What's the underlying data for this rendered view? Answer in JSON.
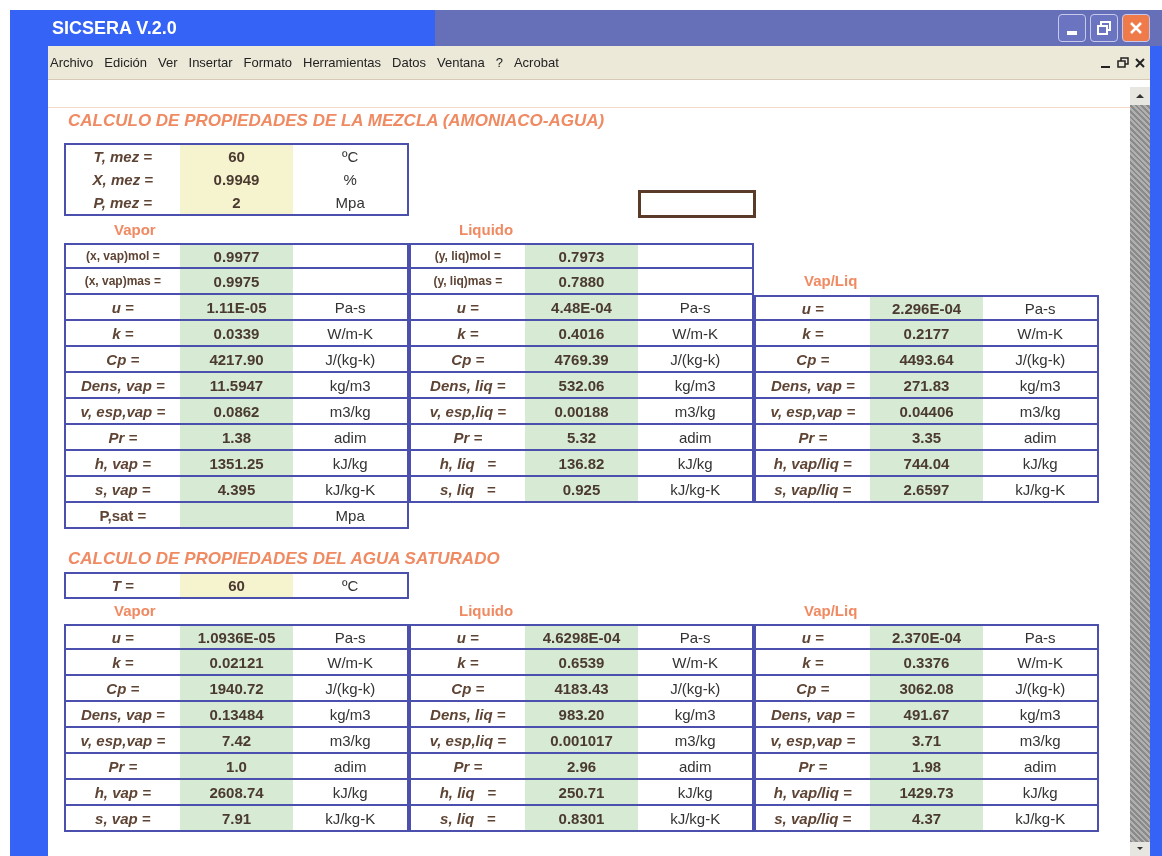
{
  "window": {
    "title": "SICSERA V.2.0"
  },
  "menu": [
    "Archivo",
    "Edición",
    "Ver",
    "Insertar",
    "Formato",
    "Herramientas",
    "Datos",
    "Ventana",
    "?",
    "Acrobat"
  ],
  "sections": [
    {
      "title": "CALCULO DE PROPIEDADES DE LA MEZCLA (AMONIACO-AGUA)",
      "inputs": [
        {
          "label": "T, mez =",
          "value": "60",
          "unit": "ºC"
        },
        {
          "label": "X, mez =",
          "value": "0.9949",
          "unit": "%"
        },
        {
          "label": "P, mez =",
          "value": "2",
          "unit": "Mpa"
        }
      ],
      "phases": [
        {
          "heading": "Vapor",
          "fractions": [
            {
              "label": "(x, vap)mol =",
              "value": "0.9977"
            },
            {
              "label": "(x, vap)mas =",
              "value": "0.9975"
            }
          ],
          "properties": [
            {
              "label": "u =",
              "value": "1.11E-05",
              "unit": "Pa-s"
            },
            {
              "label": "k =",
              "value": "0.0339",
              "unit": "W/m-K"
            },
            {
              "label": "Cp =",
              "value": "4217.90",
              "unit": "J/(kg-k)"
            },
            {
              "label": "Dens, vap =",
              "value": "11.5947",
              "unit": "kg/m3"
            },
            {
              "label": "v, esp,vap =",
              "value": "0.0862",
              "unit": "m3/kg"
            },
            {
              "label": "Pr =",
              "value": "1.38",
              "unit": "adim"
            },
            {
              "label": "h, vap =",
              "value": "1351.25",
              "unit": "kJ/kg"
            },
            {
              "label": "s, vap =",
              "value": "4.395",
              "unit": "kJ/kg-K"
            }
          ],
          "extra": [
            {
              "label": "P,sat =",
              "unit": "Mpa"
            }
          ]
        },
        {
          "heading": "Liquido",
          "fractions": [
            {
              "label": "(y, liq)mol =",
              "value": "0.7973"
            },
            {
              "label": "(y, liq)mas =",
              "value": "0.7880"
            }
          ],
          "properties": [
            {
              "label": "u =",
              "value": "4.48E-04",
              "unit": "Pa-s"
            },
            {
              "label": "k =",
              "value": "0.4016",
              "unit": "W/m-K"
            },
            {
              "label": "Cp =",
              "value": "4769.39",
              "unit": "J/(kg-k)"
            },
            {
              "label": "Dens, liq =",
              "value": "532.06",
              "unit": "kg/m3"
            },
            {
              "label": "v, esp,liq =",
              "value": "0.00188",
              "unit": "m3/kg"
            },
            {
              "label": "Pr =",
              "value": "5.32",
              "unit": "adim"
            },
            {
              "label": "h, liq   =",
              "value": "136.82",
              "unit": "kJ/kg"
            },
            {
              "label": "s, liq   =",
              "value": "0.925",
              "unit": "kJ/kg-K"
            }
          ]
        },
        {
          "heading": "Vap/Liq",
          "properties": [
            {
              "label": "u =",
              "value": "2.296E-04",
              "unit": "Pa-s"
            },
            {
              "label": "k =",
              "value": "0.2177",
              "unit": "W/m-K"
            },
            {
              "label": "Cp =",
              "value": "4493.64",
              "unit": "J/(kg-k)"
            },
            {
              "label": "Dens, vap =",
              "value": "271.83",
              "unit": "kg/m3"
            },
            {
              "label": "v, esp,vap =",
              "value": "0.04406",
              "unit": "m3/kg"
            },
            {
              "label": "Pr =",
              "value": "3.35",
              "unit": "adim"
            },
            {
              "label": "h, vap/liq =",
              "value": "744.04",
              "unit": "kJ/kg"
            },
            {
              "label": "s, vap/liq =",
              "value": "2.6597",
              "unit": "kJ/kg-K"
            }
          ]
        }
      ]
    },
    {
      "title": "CALCULO DE PROPIEDADES DEL AGUA SATURADO",
      "inputs": [
        {
          "label": "T =",
          "value": "60",
          "unit": "ºC"
        }
      ],
      "phases": [
        {
          "heading": "Vapor",
          "properties": [
            {
              "label": "u =",
              "value": "1.0936E-05",
              "unit": "Pa-s"
            },
            {
              "label": "k =",
              "value": "0.02121",
              "unit": "W/m-K"
            },
            {
              "label": "Cp =",
              "value": "1940.72",
              "unit": "J/(kg-k)"
            },
            {
              "label": "Dens, vap =",
              "value": "0.13484",
              "unit": "kg/m3"
            },
            {
              "label": "v, esp,vap =",
              "value": "7.42",
              "unit": "m3/kg"
            },
            {
              "label": "Pr =",
              "value": "1.0",
              "unit": "adim"
            },
            {
              "label": "h, vap =",
              "value": "2608.74",
              "unit": "kJ/kg"
            },
            {
              "label": "s, vap =",
              "value": "7.91",
              "unit": "kJ/kg-K"
            }
          ]
        },
        {
          "heading": "Liquido",
          "properties": [
            {
              "label": "u =",
              "value": "4.6298E-04",
              "unit": "Pa-s"
            },
            {
              "label": "k =",
              "value": "0.6539",
              "unit": "W/m-K"
            },
            {
              "label": "Cp =",
              "value": "4183.43",
              "unit": "J/(kg-k)"
            },
            {
              "label": "Dens, liq =",
              "value": "983.20",
              "unit": "kg/m3"
            },
            {
              "label": "v, esp,liq =",
              "value": "0.001017",
              "unit": "m3/kg"
            },
            {
              "label": "Pr =",
              "value": "2.96",
              "unit": "adim"
            },
            {
              "label": "h, liq   =",
              "value": "250.71",
              "unit": "kJ/kg"
            },
            {
              "label": "s, liq   =",
              "value": "0.8301",
              "unit": "kJ/kg-K"
            }
          ]
        },
        {
          "heading": "Vap/Liq",
          "properties": [
            {
              "label": "u =",
              "value": "2.370E-04",
              "unit": "Pa-s"
            },
            {
              "label": "k =",
              "value": "0.3376",
              "unit": "W/m-K"
            },
            {
              "label": "Cp =",
              "value": "3062.08",
              "unit": "J/(kg-k)"
            },
            {
              "label": "Dens, vap =",
              "value": "491.67",
              "unit": "kg/m3"
            },
            {
              "label": "v, esp,vap =",
              "value": "3.71",
              "unit": "m3/kg"
            },
            {
              "label": "Pr =",
              "value": "1.98",
              "unit": "adim"
            },
            {
              "label": "h, vap/liq =",
              "value": "1429.73",
              "unit": "kJ/kg"
            },
            {
              "label": "s, vap/liq =",
              "value": "4.37",
              "unit": "kJ/kg-K"
            }
          ]
        }
      ]
    }
  ]
}
